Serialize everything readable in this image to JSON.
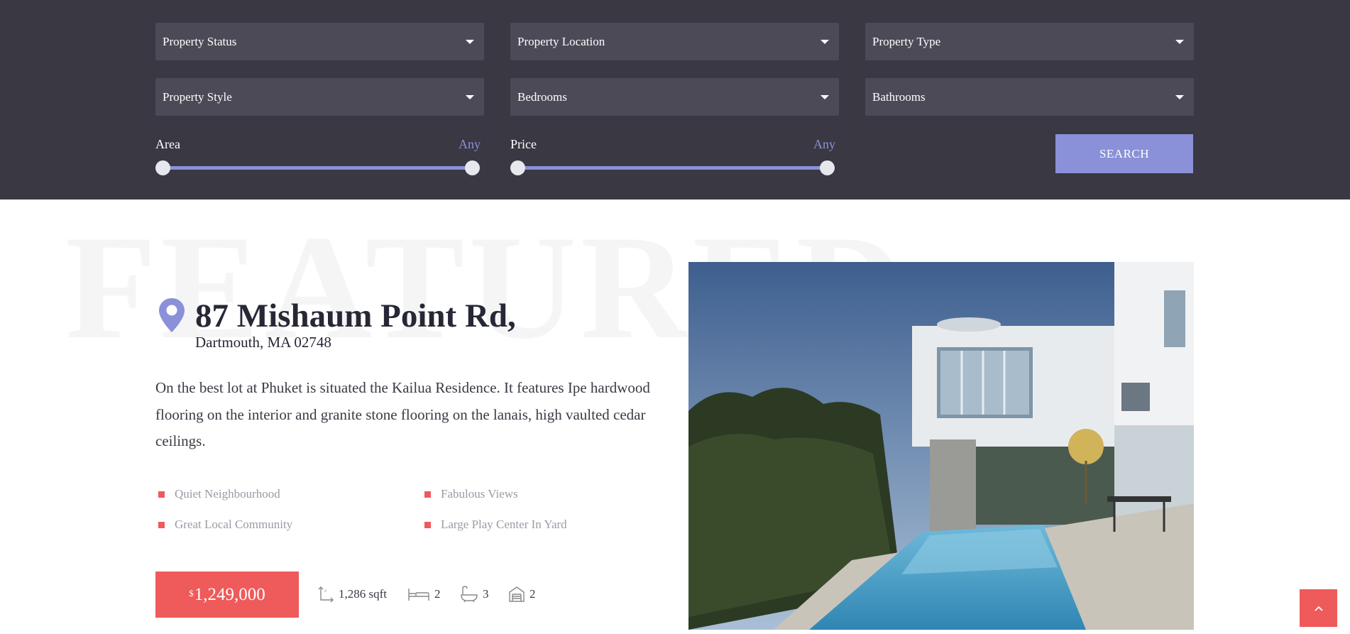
{
  "filters": {
    "row1": [
      "Property Status",
      "Property Location",
      "Property Type"
    ],
    "row2": [
      "Property Style",
      "Bedrooms",
      "Bathrooms"
    ]
  },
  "ranges": {
    "area": {
      "label": "Area",
      "value": "Any"
    },
    "price": {
      "label": "Price",
      "value": "Any"
    }
  },
  "search_button": "SEARCH",
  "featured": {
    "watermark": "FEATURED",
    "address": "87 Mishaum Point Rd,",
    "city": "Dartmouth, MA 02748",
    "description": "On the best lot at Phuket is situated the Kailua Residence. It features Ipe hardwood flooring on the interior and granite stone flooring on the lanais, high vaulted cedar ceilings.",
    "features": [
      "Quiet Neighbourhood",
      "Fabulous Views",
      "Great Local Community",
      "Large Play Center In Yard"
    ],
    "price_currency": "$",
    "price": "1,249,000",
    "stats": {
      "area": "1,286 sqft",
      "bedrooms": "2",
      "bathrooms": "3",
      "garages": "2"
    }
  },
  "icons": {
    "location": "map-pin-icon",
    "area": "area-icon",
    "bed": "bed-icon",
    "bath": "bath-icon",
    "garage": "garage-icon",
    "scroll_top": "chevron-up-icon"
  },
  "colors": {
    "panel_bg": "#3a3843",
    "select_bg": "#4d4a57",
    "accent": "#8a91d8",
    "price_red": "#ef5a5a"
  }
}
